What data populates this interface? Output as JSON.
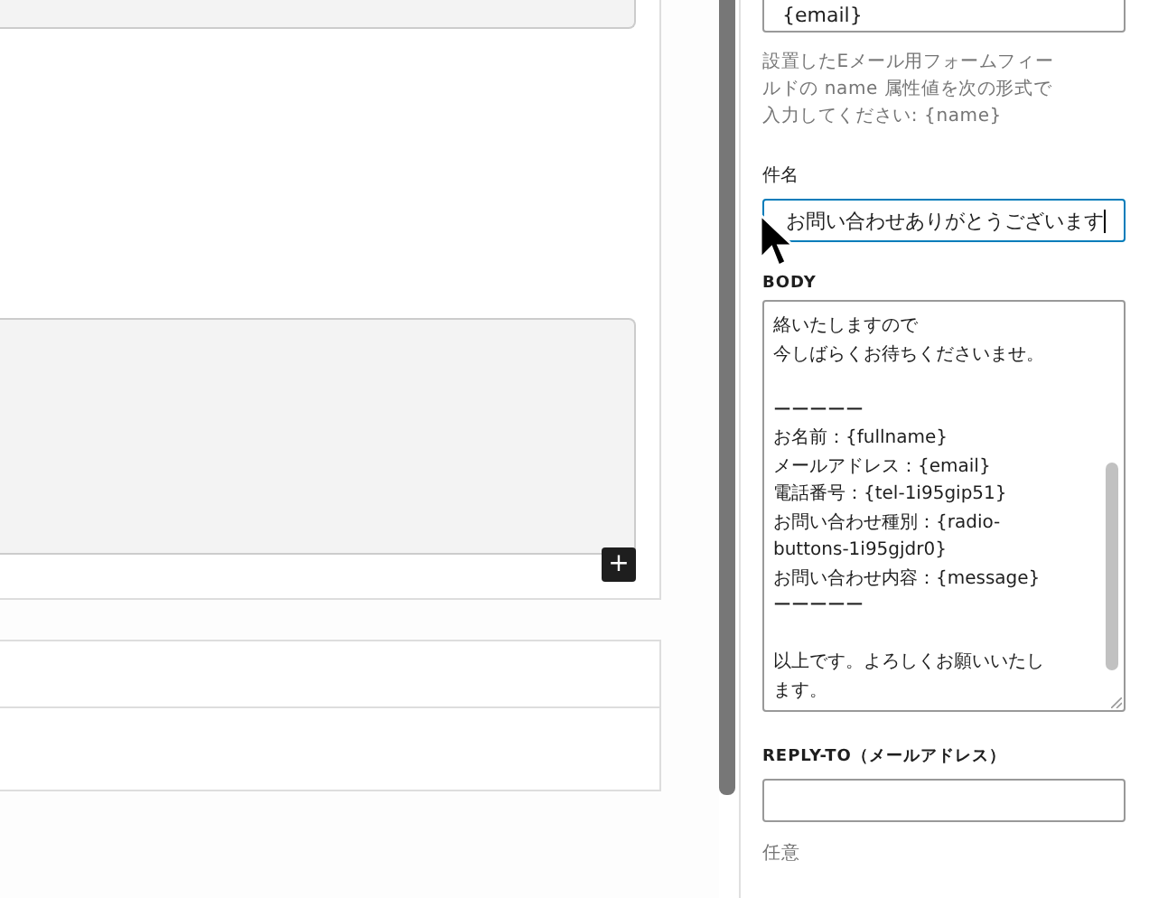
{
  "editor": {
    "add_button": "+"
  },
  "sidebar": {
    "email_field": {
      "value": "{email}"
    },
    "email_help": "設置したEメール用フォームフィールドの name 属性値を次の形式で入力してください: {name}",
    "subject": {
      "label": "件名",
      "value": "お問い合わせありがとうございます",
      "focused": true
    },
    "body": {
      "label": "BODY",
      "paragraphs": [
        [
          "絡いたしますので",
          "今しばらくお待ちくださいませ。"
        ],
        [
          "ーーーーー",
          "お名前：{fullname}",
          "メールアドレス：{email}",
          "電話番号：{tel-1i95gip51}",
          "お問い合わせ種別：{radio-",
          "buttons-1i95gjdr0}",
          "お問い合わせ内容：{message}",
          "ーーーーー"
        ],
        [
          "以上です。よろしくお願いいたし",
          "ます。"
        ]
      ]
    },
    "reply_to": {
      "label": "REPLY-TO（メールアドレス）",
      "help": "任意"
    }
  }
}
